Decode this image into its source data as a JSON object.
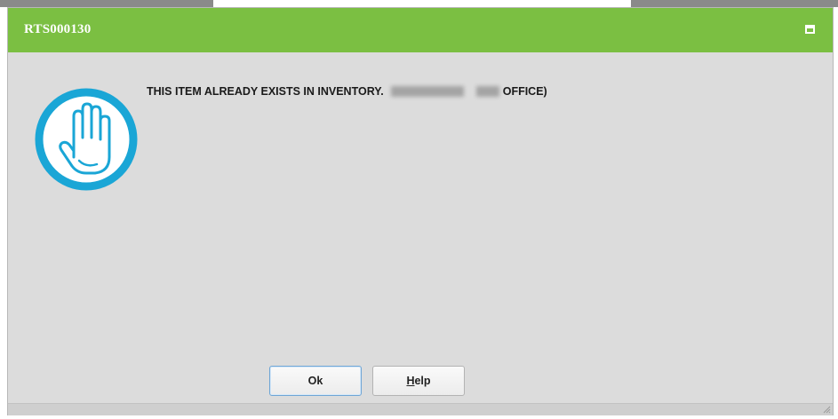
{
  "dialog": {
    "title": "RTS000130",
    "message_prefix": "THIS ITEM ALREADY EXISTS IN INVENTORY.",
    "message_suffix": "OFFICE)",
    "icon": "stop-hand-icon",
    "buttons": {
      "ok_label": "Ok",
      "help_mnemonic": "H",
      "help_rest": "elp"
    }
  },
  "colors": {
    "titlebar": "#7bbf42",
    "body": "#dcdcdc",
    "icon_accent": "#1aa6d6"
  }
}
